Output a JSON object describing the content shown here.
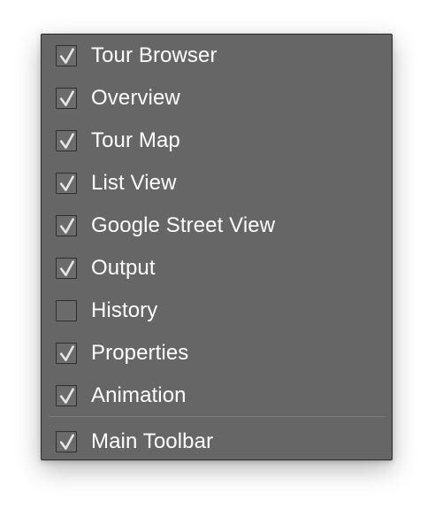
{
  "menu": {
    "items": [
      {
        "label": "Tour Browser",
        "checked": true
      },
      {
        "label": "Overview",
        "checked": true
      },
      {
        "label": "Tour Map",
        "checked": true
      },
      {
        "label": "List View",
        "checked": true
      },
      {
        "label": "Google Street View",
        "checked": true
      },
      {
        "label": "Output",
        "checked": true
      },
      {
        "label": "History",
        "checked": false
      },
      {
        "label": "Properties",
        "checked": true
      },
      {
        "label": "Animation",
        "checked": true
      }
    ],
    "footer_item": {
      "label": "Main Toolbar",
      "checked": true
    }
  },
  "colors": {
    "menu_background": "#666666",
    "text": "#ffffff",
    "checkmark": "#e6e6e6",
    "checkbox_border": "#2e2e2e"
  },
  "icons": {
    "checked": "checkmark-icon",
    "unchecked": "empty-checkbox"
  }
}
